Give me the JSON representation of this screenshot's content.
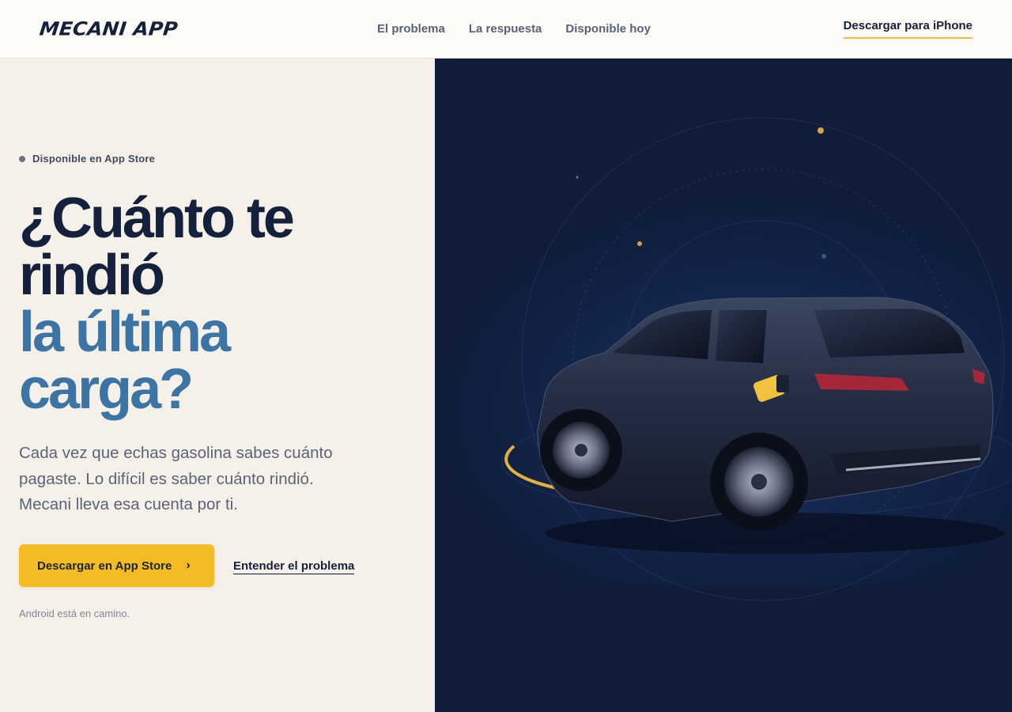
{
  "brand": {
    "logo_text": "MECANI APP"
  },
  "nav": {
    "items": [
      {
        "label": "El problema"
      },
      {
        "label": "La respuesta"
      },
      {
        "label": "Disponible hoy"
      }
    ],
    "cta_label": "Descargar para iPhone"
  },
  "hero": {
    "eyebrow": "Disponible en App Store",
    "headline_line1": "¿Cuánto te rindió",
    "headline_line2": "la última carga?",
    "lead": "Cada vez que echas gasolina sabes cuánto pagaste. Lo difícil es saber cuánto rindió. Mecani lleva esa cuenta por ti.",
    "primary_button": "Descargar en App Store",
    "secondary_link": "Entender el problema",
    "note": "Android está en camino."
  },
  "colors": {
    "accent": "#f4bc22",
    "navy": "#14213d",
    "blue": "#3d74a6",
    "panel": "#0f1d3b"
  },
  "icons": {
    "eyebrow_dot": "status-dot-icon",
    "button_chevron": "chevron-right-icon"
  }
}
